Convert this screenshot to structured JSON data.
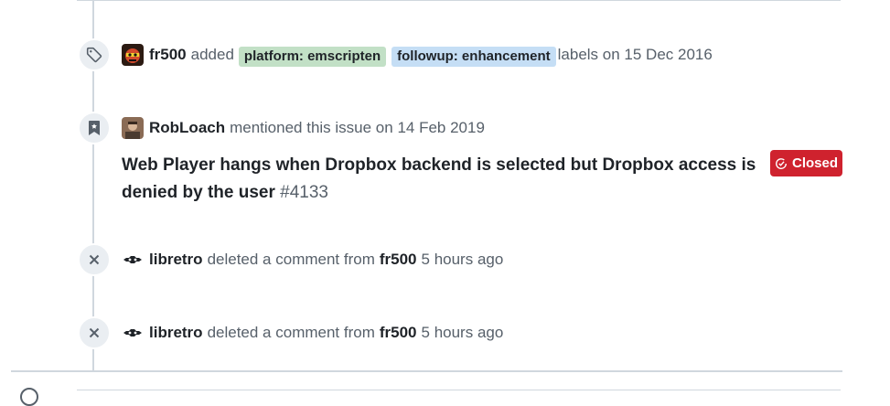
{
  "timeline": {
    "label_event": {
      "icon": "tag-icon",
      "actor": "fr500",
      "verb": "added",
      "labels": [
        {
          "text": "platform: emscripten",
          "color": "#c2e0c6"
        },
        {
          "text": "followup: enhancement",
          "color": "#c5def5"
        }
      ],
      "suffix": "labels on 15 Dec 2016"
    },
    "mention_event": {
      "icon": "bookmark-icon",
      "actor": "RobLoach",
      "text": "mentioned this issue on 14 Feb 2019",
      "issue_title": "Web Player hangs when Dropbox backend is selected but Dropbox access is denied by the user",
      "issue_number": "#4133",
      "state": "Closed",
      "state_color": "#cf222e"
    },
    "delete_events": [
      {
        "icon": "x-icon",
        "actor": "libretro",
        "action": "deleted a comment from",
        "target": "fr500",
        "time": "5 hours ago"
      },
      {
        "icon": "x-icon",
        "actor": "libretro",
        "action": "deleted a comment from",
        "target": "fr500",
        "time": "5 hours ago"
      }
    ]
  }
}
